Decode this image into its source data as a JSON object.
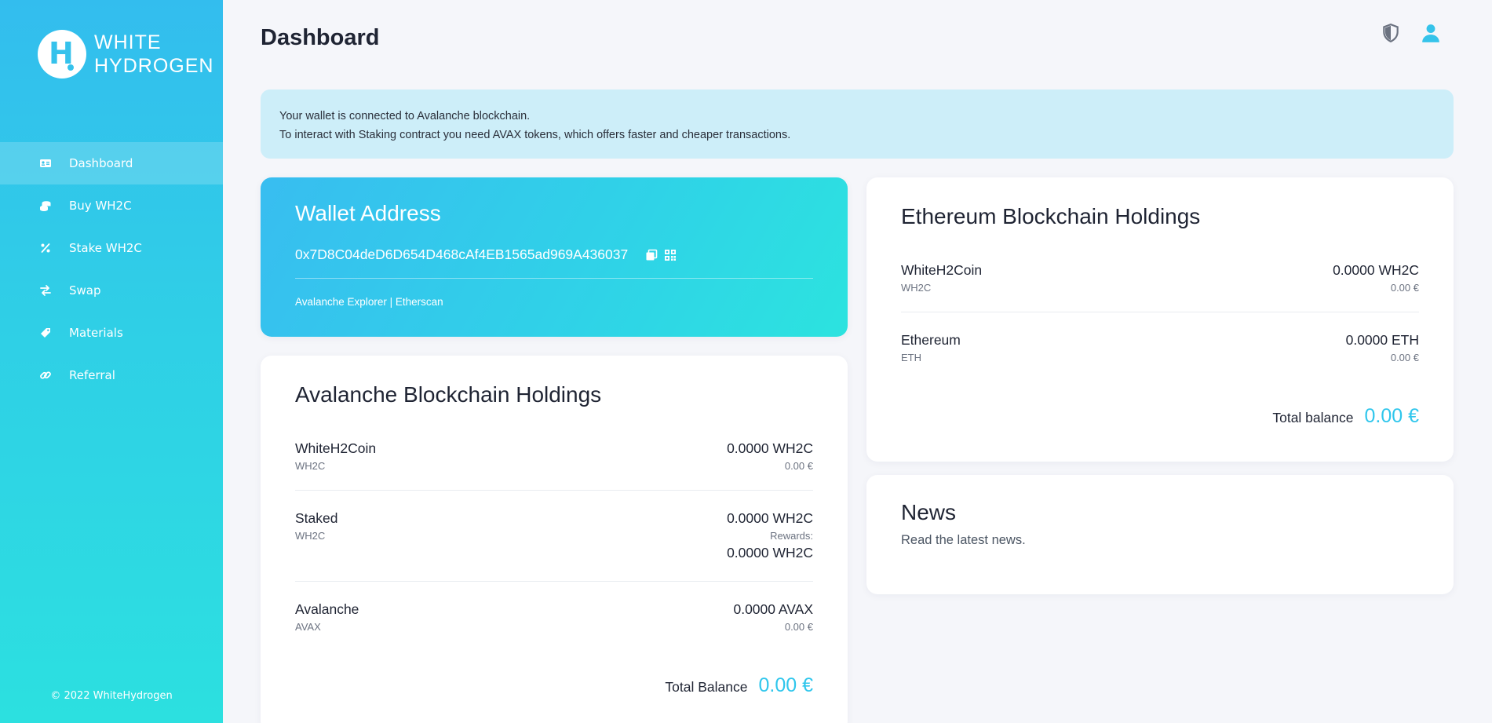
{
  "brand": {
    "logo_letter": "H",
    "name_line1": "WHITE",
    "name_line2": "HYDROGEN"
  },
  "sidebar": {
    "items": [
      {
        "label": "Dashboard",
        "icon": "id-card-icon",
        "active": true
      },
      {
        "label": "Buy WH2C",
        "icon": "coins-icon",
        "active": false
      },
      {
        "label": "Stake WH2C",
        "icon": "percent-icon",
        "active": false
      },
      {
        "label": "Swap",
        "icon": "swap-arrows-icon",
        "active": false
      },
      {
        "label": "Materials",
        "icon": "tag-icon",
        "active": false
      },
      {
        "label": "Referral",
        "icon": "link-icon",
        "active": false
      }
    ],
    "footer": "© 2022 WhiteHydrogen"
  },
  "header": {
    "title": "Dashboard",
    "icons": [
      "shield-icon",
      "user-icon"
    ]
  },
  "alert": {
    "line1": "Your wallet is connected to Avalanche blockchain.",
    "line2": "To interact with Staking contract you need AVAX tokens, which offers faster and cheaper transactions."
  },
  "wallet": {
    "title": "Wallet Address",
    "address": "0x7D8C04deD6D654D468cAf4EB1565ad969A436037",
    "link_avalanche": "Avalanche Explorer",
    "link_separator": " | ",
    "link_etherscan": "Etherscan"
  },
  "avalanche": {
    "title": "Avalanche Blockchain Holdings",
    "rows": [
      {
        "name": "WhiteH2Coin",
        "symbol": "WH2C",
        "amount": "0.0000 WH2C",
        "eur": "0.00 €"
      },
      {
        "name": "Staked",
        "symbol": "WH2C",
        "amount": "0.0000 WH2C",
        "rewards_label": "Rewards:",
        "rewards_amount": "0.0000 WH2C"
      },
      {
        "name": "Avalanche",
        "symbol": "AVAX",
        "amount": "0.0000 AVAX",
        "eur": "0.00 €"
      }
    ],
    "total_label": "Total Balance",
    "total_value": "0.00 €"
  },
  "ethereum": {
    "title": "Ethereum Blockchain Holdings",
    "rows": [
      {
        "name": "WhiteH2Coin",
        "symbol": "WH2C",
        "amount": "0.0000 WH2C",
        "eur": "0.00 €"
      },
      {
        "name": "Ethereum",
        "symbol": "ETH",
        "amount": "0.0000 ETH",
        "eur": "0.00 €"
      }
    ],
    "total_label": "Total balance",
    "total_value": "0.00 €"
  },
  "news": {
    "title": "News",
    "subtitle": "Read the latest news."
  },
  "colors": {
    "accent": "#2fc6ec",
    "sidebar_top": "#33bdee",
    "sidebar_bottom": "#2ce0e0",
    "alert_bg": "#cdeef9"
  }
}
